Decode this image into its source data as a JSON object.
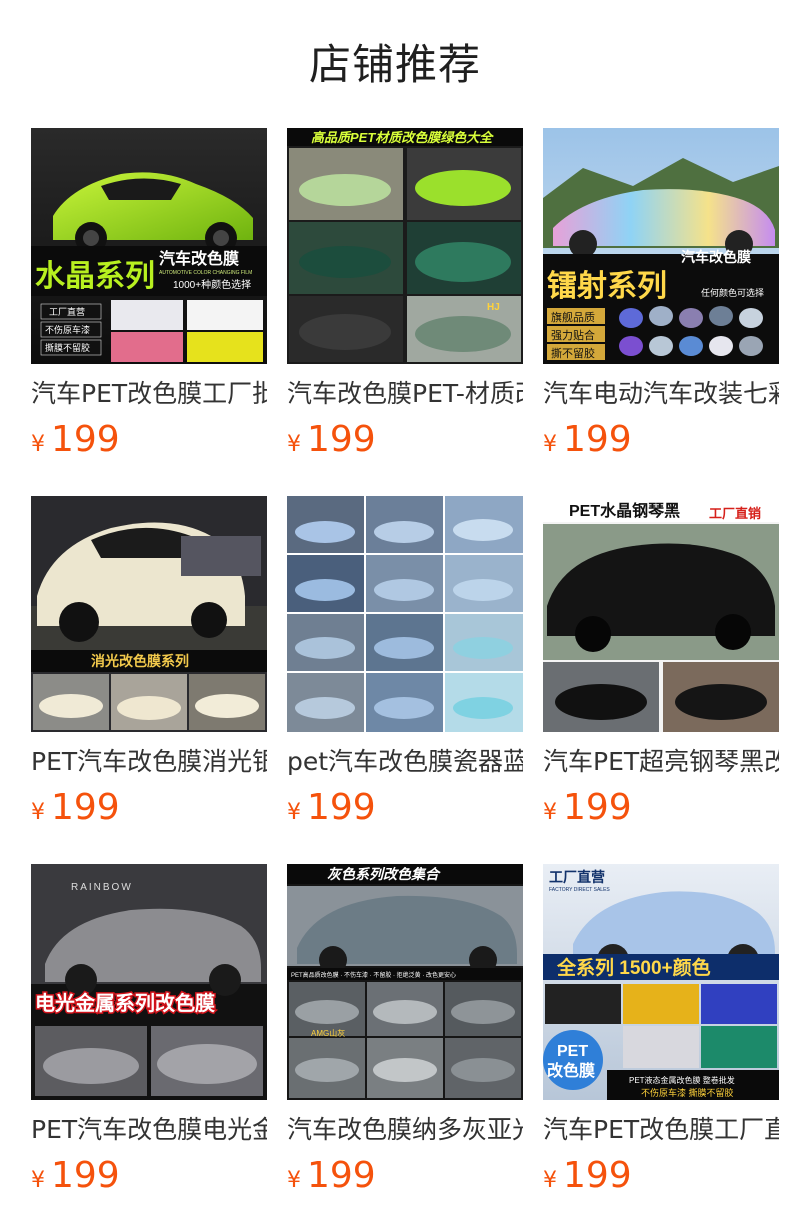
{
  "page": {
    "title": "店铺推荐"
  },
  "products": [
    {
      "name": "汽车PET改色膜工厂批发",
      "currency": "¥",
      "price": "199",
      "image": {
        "headline": "水晶系列",
        "sub": "汽车改色膜",
        "sub_en": "AUTOMOTIVE COLOR CHANGING FILM",
        "note": "1000+种颜色选择",
        "tags": [
          "工厂直营",
          "不伤原车漆",
          "撕膜不留胶"
        ]
      }
    },
    {
      "name": "汽车改色膜PET-材质改色膜",
      "currency": "¥",
      "price": "199",
      "image": {
        "headline": "高品质PET材质改色膜绿色大全",
        "mark": "HJ"
      }
    },
    {
      "name": "汽车电动汽车改装七彩镭射",
      "currency": "¥",
      "price": "199",
      "image": {
        "headline": "镭射系列",
        "sub": "汽车改色膜",
        "note": "任何颜色可选择",
        "tags": [
          "旗舰品质",
          "强力贴合",
          "撕不留胶"
        ]
      }
    },
    {
      "name": "PET汽车改色膜消光银色",
      "currency": "¥",
      "price": "199",
      "image": {
        "headline": "消光改色膜系列"
      }
    },
    {
      "name": "pet汽车改色膜瓷器蓝色系",
      "currency": "¥",
      "price": "199",
      "image": {}
    },
    {
      "name": "汽车PET超亮钢琴黑改色",
      "currency": "¥",
      "price": "199",
      "image": {
        "headline": "PET水晶钢琴黑",
        "tag": "工厂直销"
      }
    },
    {
      "name": "PET汽车改色膜电光金属",
      "currency": "¥",
      "price": "199",
      "image": {
        "brand": "RAINBOW",
        "headline": "电光金属系列改色膜"
      }
    },
    {
      "name": "汽车改色膜纳多灰亚光",
      "currency": "¥",
      "price": "199",
      "image": {
        "headline": "灰色系列改色集合",
        "strip": "PET高品质改色膜 · 不伤车漆 · 不留胶 · 拒绝泛黄 · 改色更安心",
        "model": "AMG山灰"
      }
    },
    {
      "name": "汽车PET改色膜工厂直营",
      "currency": "¥",
      "price": "199",
      "image": {
        "corner": "工厂直营",
        "corner_en": "FACTORY DIRECT SALES",
        "headline": "全系列 1500+颜色",
        "badge1": "PET",
        "badge2": "改色膜",
        "foot": "PET液态金属改色膜 整卷批发",
        "foot2": "不伤原车漆 撕膜不留胶"
      }
    }
  ]
}
